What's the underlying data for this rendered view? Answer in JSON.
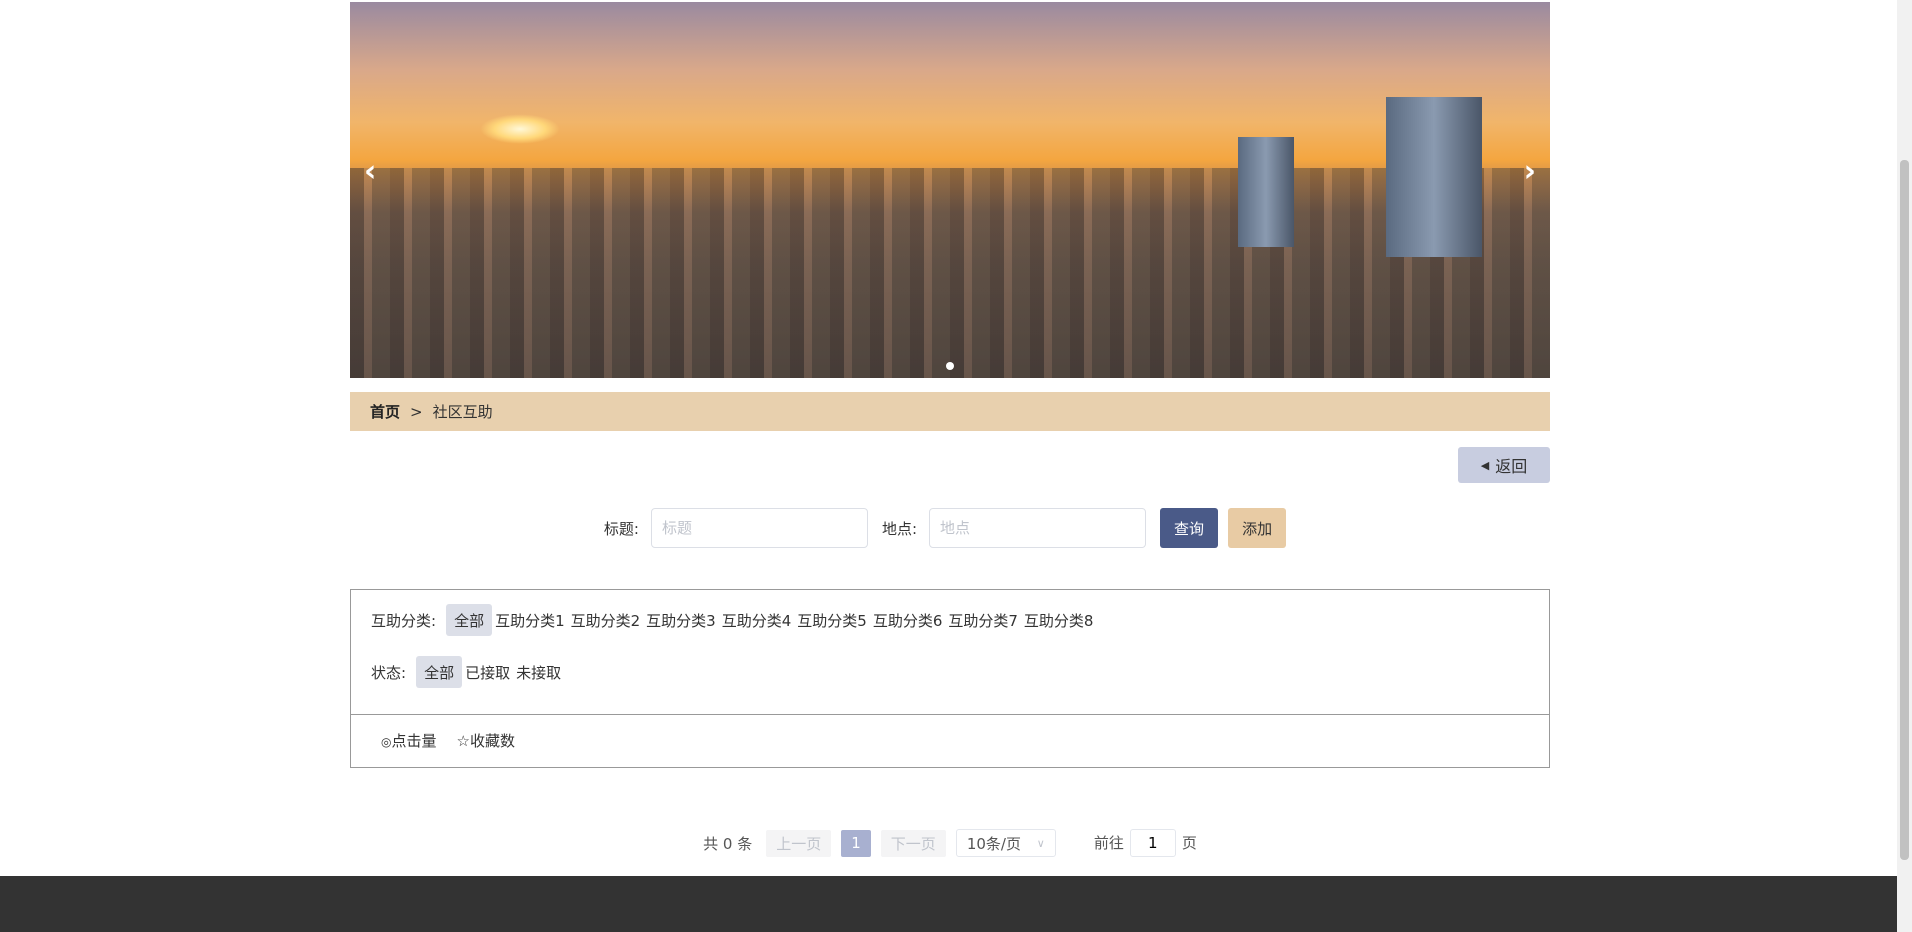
{
  "breadcrumb": {
    "home": "首页",
    "sep": ">",
    "current": "社区互助"
  },
  "back_label": "返回",
  "search": {
    "title_label": "标题:",
    "title_placeholder": "标题",
    "place_label": "地点:",
    "place_placeholder": "地点",
    "query": "查询",
    "add": "添加"
  },
  "filter": {
    "category_label": "互助分类:",
    "categories": [
      "全部",
      "互助分类1",
      "互助分类2",
      "互助分类3",
      "互助分类4",
      "互助分类5",
      "互助分类6",
      "互助分类7",
      "互助分类8"
    ],
    "status_label": "状态:",
    "statuses": [
      "全部",
      "已接取",
      "未接取"
    ]
  },
  "sort": {
    "clicks": "点击量",
    "favorites": "收藏数"
  },
  "pager": {
    "total": "共 0 条",
    "prev": "上一页",
    "page": "1",
    "next": "下一页",
    "size": "10条/页",
    "goto": "前往",
    "goto_value": "1",
    "page_unit": "页"
  }
}
